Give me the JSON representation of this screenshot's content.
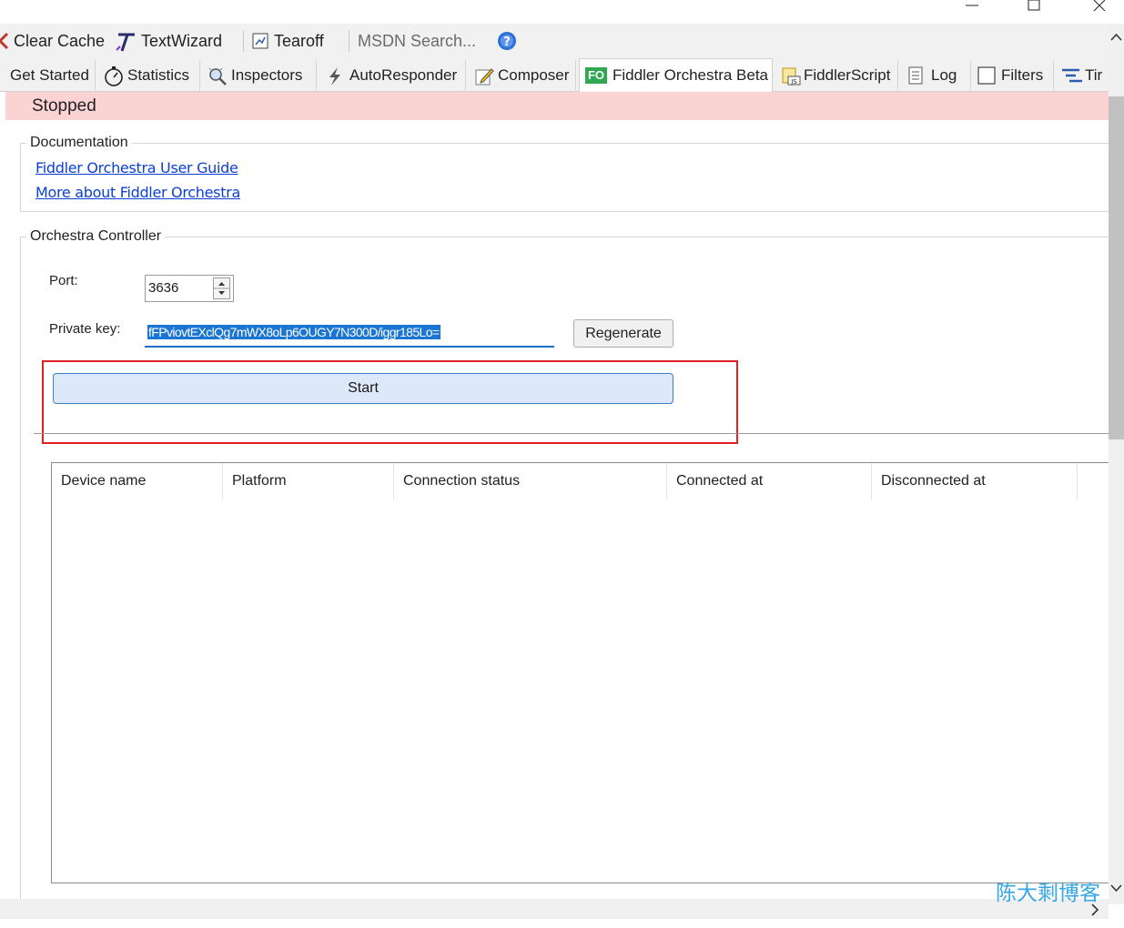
{
  "toolbar": {
    "clear_cache": "Clear Cache",
    "textwizard": "TextWizard",
    "tearoff": "Tearoff",
    "msdn_search_placeholder": "MSDN Search..."
  },
  "tabs": [
    {
      "label": "Get Started",
      "icon": "none"
    },
    {
      "label": "Statistics",
      "icon": "stopwatch-icon"
    },
    {
      "label": "Inspectors",
      "icon": "magnifier-icon"
    },
    {
      "label": "AutoResponder",
      "icon": "lightning-icon"
    },
    {
      "label": "Composer",
      "icon": "pencil-icon"
    },
    {
      "label": "Fiddler Orchestra Beta",
      "icon": "fo-icon",
      "badge": "FO"
    },
    {
      "label": "FiddlerScript",
      "icon": "script-icon"
    },
    {
      "label": "Log",
      "icon": "log-icon"
    },
    {
      "label": "Filters",
      "icon": "checkbox-icon"
    },
    {
      "label": "Tir",
      "icon": "timeline-icon"
    }
  ],
  "status": "Stopped",
  "documentation": {
    "legend": "Documentation",
    "links": [
      "Fiddler Orchestra User Guide",
      "More about Fiddler Orchestra"
    ]
  },
  "controller": {
    "legend": "Orchestra Controller",
    "port_label": "Port:",
    "port_value": "3636",
    "key_label": "Private key:",
    "key_value": "fFPviovtEXclQg7mWX8oLp6OUGY7N300D/iggr185Lo=",
    "regenerate": "Regenerate",
    "start": "Start"
  },
  "devices": {
    "columns": [
      "Device name",
      "Platform",
      "Connection status",
      "Connected at",
      "Disconnected at"
    ],
    "rows": []
  },
  "watermark": "陈大剩博客",
  "colors": {
    "status_bg": "#fcd3d3",
    "link": "#0b3fd6",
    "highlight_box": "#e02020",
    "start_bg": "#dde9f8",
    "selection": "#1a76d2"
  }
}
